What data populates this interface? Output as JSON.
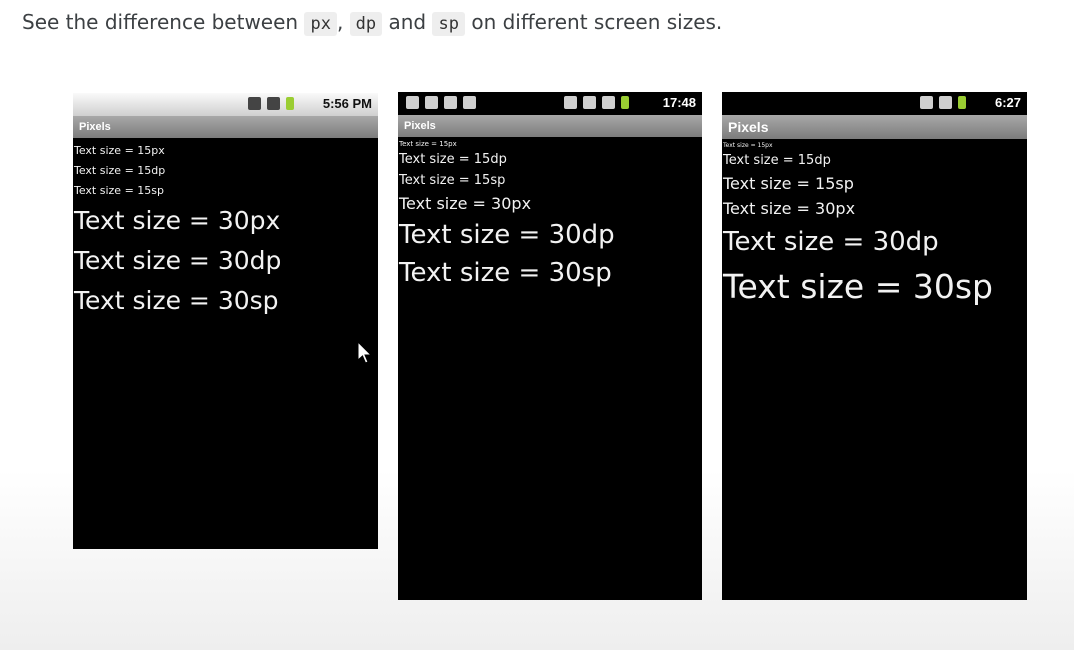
{
  "intro": {
    "before": "See the difference between ",
    "code1": "px",
    "sep1": ", ",
    "code2": "dp",
    "sep2": " and ",
    "code3": "sp",
    "after": " on different screen sizes."
  },
  "phones": [
    {
      "status_icons": [
        "sim-icon",
        "signal-icon",
        "battery-icon"
      ],
      "time": "5:56 PM",
      "title": "Pixels",
      "lines": [
        {
          "text": "Text size = 15px"
        },
        {
          "text": "Text size = 15dp"
        },
        {
          "text": "Text size = 15sp"
        },
        {
          "text": "Text size = 30px"
        },
        {
          "text": "Text size = 30dp"
        },
        {
          "text": "Text size = 30sp"
        }
      ]
    },
    {
      "status_icons": [
        "briefcase-icon",
        "twitter-icon",
        "usb-icon",
        "android-icon",
        "sync-icon",
        "sd-card-icon",
        "signal-icon",
        "battery-icon"
      ],
      "time": "17:48",
      "title": "Pixels",
      "lines": [
        {
          "text": "Text size = 15px"
        },
        {
          "text": "Text size = 15dp"
        },
        {
          "text": "Text size = 15sp"
        },
        {
          "text": "Text size = 30px"
        },
        {
          "text": "Text size = 30dp"
        },
        {
          "text": "Text size = 30sp"
        }
      ]
    },
    {
      "status_icons": [
        "sd-card-icon",
        "signal-icon",
        "battery-icon"
      ],
      "time": "6:27",
      "title": "Pixels",
      "lines": [
        {
          "text": "Text size = 15px"
        },
        {
          "text": "Text size = 15dp"
        },
        {
          "text": "Text size = 15sp"
        },
        {
          "text": "Text size = 30px"
        },
        {
          "text": "Text size = 30dp"
        },
        {
          "text": "Text size = 30sp"
        }
      ]
    }
  ]
}
